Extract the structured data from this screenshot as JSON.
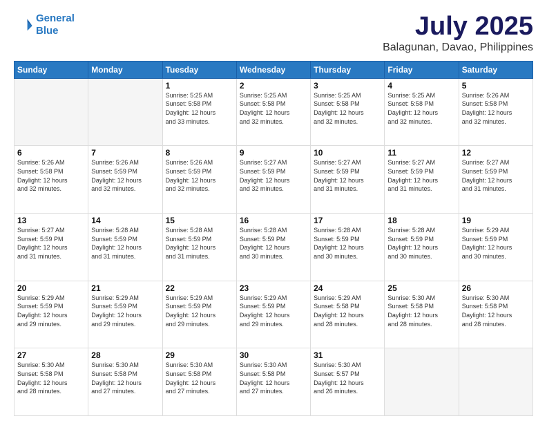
{
  "logo": {
    "line1": "General",
    "line2": "Blue"
  },
  "title": "July 2025",
  "subtitle": "Balagunan, Davao, Philippines",
  "weekdays": [
    "Sunday",
    "Monday",
    "Tuesday",
    "Wednesday",
    "Thursday",
    "Friday",
    "Saturday"
  ],
  "weeks": [
    [
      {
        "day": "",
        "info": ""
      },
      {
        "day": "",
        "info": ""
      },
      {
        "day": "1",
        "info": "Sunrise: 5:25 AM\nSunset: 5:58 PM\nDaylight: 12 hours\nand 33 minutes."
      },
      {
        "day": "2",
        "info": "Sunrise: 5:25 AM\nSunset: 5:58 PM\nDaylight: 12 hours\nand 32 minutes."
      },
      {
        "day": "3",
        "info": "Sunrise: 5:25 AM\nSunset: 5:58 PM\nDaylight: 12 hours\nand 32 minutes."
      },
      {
        "day": "4",
        "info": "Sunrise: 5:25 AM\nSunset: 5:58 PM\nDaylight: 12 hours\nand 32 minutes."
      },
      {
        "day": "5",
        "info": "Sunrise: 5:26 AM\nSunset: 5:58 PM\nDaylight: 12 hours\nand 32 minutes."
      }
    ],
    [
      {
        "day": "6",
        "info": "Sunrise: 5:26 AM\nSunset: 5:58 PM\nDaylight: 12 hours\nand 32 minutes."
      },
      {
        "day": "7",
        "info": "Sunrise: 5:26 AM\nSunset: 5:59 PM\nDaylight: 12 hours\nand 32 minutes."
      },
      {
        "day": "8",
        "info": "Sunrise: 5:26 AM\nSunset: 5:59 PM\nDaylight: 12 hours\nand 32 minutes."
      },
      {
        "day": "9",
        "info": "Sunrise: 5:27 AM\nSunset: 5:59 PM\nDaylight: 12 hours\nand 32 minutes."
      },
      {
        "day": "10",
        "info": "Sunrise: 5:27 AM\nSunset: 5:59 PM\nDaylight: 12 hours\nand 31 minutes."
      },
      {
        "day": "11",
        "info": "Sunrise: 5:27 AM\nSunset: 5:59 PM\nDaylight: 12 hours\nand 31 minutes."
      },
      {
        "day": "12",
        "info": "Sunrise: 5:27 AM\nSunset: 5:59 PM\nDaylight: 12 hours\nand 31 minutes."
      }
    ],
    [
      {
        "day": "13",
        "info": "Sunrise: 5:27 AM\nSunset: 5:59 PM\nDaylight: 12 hours\nand 31 minutes."
      },
      {
        "day": "14",
        "info": "Sunrise: 5:28 AM\nSunset: 5:59 PM\nDaylight: 12 hours\nand 31 minutes."
      },
      {
        "day": "15",
        "info": "Sunrise: 5:28 AM\nSunset: 5:59 PM\nDaylight: 12 hours\nand 31 minutes."
      },
      {
        "day": "16",
        "info": "Sunrise: 5:28 AM\nSunset: 5:59 PM\nDaylight: 12 hours\nand 30 minutes."
      },
      {
        "day": "17",
        "info": "Sunrise: 5:28 AM\nSunset: 5:59 PM\nDaylight: 12 hours\nand 30 minutes."
      },
      {
        "day": "18",
        "info": "Sunrise: 5:28 AM\nSunset: 5:59 PM\nDaylight: 12 hours\nand 30 minutes."
      },
      {
        "day": "19",
        "info": "Sunrise: 5:29 AM\nSunset: 5:59 PM\nDaylight: 12 hours\nand 30 minutes."
      }
    ],
    [
      {
        "day": "20",
        "info": "Sunrise: 5:29 AM\nSunset: 5:59 PM\nDaylight: 12 hours\nand 29 minutes."
      },
      {
        "day": "21",
        "info": "Sunrise: 5:29 AM\nSunset: 5:59 PM\nDaylight: 12 hours\nand 29 minutes."
      },
      {
        "day": "22",
        "info": "Sunrise: 5:29 AM\nSunset: 5:59 PM\nDaylight: 12 hours\nand 29 minutes."
      },
      {
        "day": "23",
        "info": "Sunrise: 5:29 AM\nSunset: 5:59 PM\nDaylight: 12 hours\nand 29 minutes."
      },
      {
        "day": "24",
        "info": "Sunrise: 5:29 AM\nSunset: 5:58 PM\nDaylight: 12 hours\nand 28 minutes."
      },
      {
        "day": "25",
        "info": "Sunrise: 5:30 AM\nSunset: 5:58 PM\nDaylight: 12 hours\nand 28 minutes."
      },
      {
        "day": "26",
        "info": "Sunrise: 5:30 AM\nSunset: 5:58 PM\nDaylight: 12 hours\nand 28 minutes."
      }
    ],
    [
      {
        "day": "27",
        "info": "Sunrise: 5:30 AM\nSunset: 5:58 PM\nDaylight: 12 hours\nand 28 minutes."
      },
      {
        "day": "28",
        "info": "Sunrise: 5:30 AM\nSunset: 5:58 PM\nDaylight: 12 hours\nand 27 minutes."
      },
      {
        "day": "29",
        "info": "Sunrise: 5:30 AM\nSunset: 5:58 PM\nDaylight: 12 hours\nand 27 minutes."
      },
      {
        "day": "30",
        "info": "Sunrise: 5:30 AM\nSunset: 5:58 PM\nDaylight: 12 hours\nand 27 minutes."
      },
      {
        "day": "31",
        "info": "Sunrise: 5:30 AM\nSunset: 5:57 PM\nDaylight: 12 hours\nand 26 minutes."
      },
      {
        "day": "",
        "info": ""
      },
      {
        "day": "",
        "info": ""
      }
    ]
  ]
}
